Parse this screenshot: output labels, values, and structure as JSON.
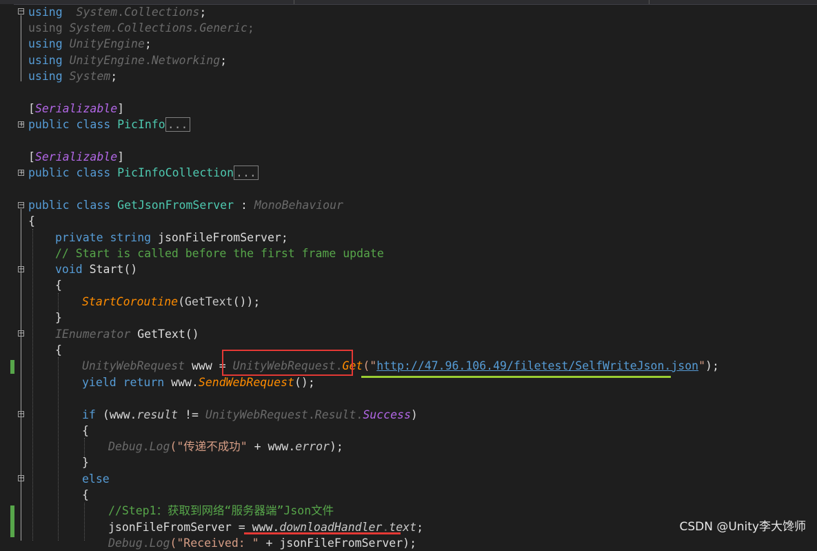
{
  "editor": {
    "lines": [
      {
        "id": "l1",
        "parts": [
          [
            "kw",
            "using"
          ],
          [
            "",
            "  "
          ],
          [
            "tyi",
            "System"
          ],
          [
            "dim",
            "."
          ],
          [
            "tyi",
            "Collections"
          ],
          [
            "",
            "; "
          ]
        ]
      },
      {
        "id": "l2",
        "parts": [
          [
            "dim",
            "using "
          ],
          [
            "dimi",
            "System.Collections.Generic"
          ],
          [
            "dim",
            ";"
          ]
        ]
      },
      {
        "id": "l3",
        "parts": [
          [
            "kw",
            "using "
          ],
          [
            "tyi",
            "UnityEngine"
          ],
          [
            "",
            ";"
          ]
        ]
      },
      {
        "id": "l4",
        "parts": [
          [
            "kw",
            "using "
          ],
          [
            "tyi",
            "UnityEngine"
          ],
          [
            "dim",
            "."
          ],
          [
            "tyi",
            "Networking"
          ],
          [
            "",
            ";"
          ]
        ]
      },
      {
        "id": "l5",
        "parts": [
          [
            "kw",
            "using "
          ],
          [
            "tyi",
            "System"
          ],
          [
            "",
            ";"
          ]
        ]
      },
      {
        "id": "l6",
        "parts": [
          [
            "",
            "["
          ],
          [
            "at",
            "Serializable"
          ],
          [
            "",
            "]"
          ]
        ]
      },
      {
        "id": "l7",
        "parts": [
          [
            "kw",
            "public class "
          ],
          [
            "cl",
            "PicInfo"
          ],
          [
            "collapsed",
            "..."
          ]
        ]
      },
      {
        "id": "l8",
        "parts": [
          [
            "",
            "["
          ],
          [
            "at",
            "Serializable"
          ],
          [
            "",
            "]"
          ]
        ]
      },
      {
        "id": "l9",
        "parts": [
          [
            "kw",
            "public class "
          ],
          [
            "cl",
            "PicInfoCollection"
          ],
          [
            "collapsed",
            "..."
          ]
        ]
      },
      {
        "id": "l10",
        "parts": [
          [
            "kw",
            "public class "
          ],
          [
            "cl",
            "GetJsonFromServer"
          ],
          [
            "",
            " : "
          ],
          [
            "tyi",
            "MonoBehaviour"
          ]
        ]
      },
      {
        "id": "l11",
        "parts": [
          [
            "",
            "{"
          ]
        ]
      },
      {
        "id": "l12",
        "parts": [
          [
            "kw",
            "private string "
          ],
          [
            "",
            "jsonFileFromServer;"
          ]
        ]
      },
      {
        "id": "l13",
        "parts": [
          [
            "cm",
            "// Start is called before the first frame update"
          ]
        ]
      },
      {
        "id": "l14",
        "parts": [
          [
            "kw",
            "void "
          ],
          [
            "",
            "Start()"
          ]
        ]
      },
      {
        "id": "l15",
        "parts": [
          [
            "",
            "{"
          ]
        ]
      },
      {
        "id": "l16",
        "parts": [
          [
            "mi",
            "StartCoroutine"
          ],
          [
            "",
            "("
          ],
          [
            "pr",
            "GetText"
          ],
          [
            "",
            "());"
          ]
        ]
      },
      {
        "id": "l17",
        "parts": [
          [
            "",
            "}"
          ]
        ]
      },
      {
        "id": "l18",
        "parts": [
          [
            "tyi",
            "IEnumerator "
          ],
          [
            "",
            "GetText()"
          ]
        ]
      },
      {
        "id": "l19",
        "parts": [
          [
            "",
            "{"
          ]
        ]
      },
      {
        "id": "l20",
        "parts": [
          [
            "tyi",
            "UnityWebRequest "
          ],
          [
            "",
            "www = "
          ],
          [
            "tyi",
            "UnityWebRequest"
          ],
          [
            "dim",
            "."
          ],
          [
            "mi",
            "Get"
          ],
          [
            "st",
            "(\""
          ],
          [
            "url",
            "http://47.96.106.49/filetest/SelfWriteJson.json"
          ],
          [
            "st",
            "\""
          ],
          [
            "",
            ");"
          ]
        ]
      },
      {
        "id": "l21",
        "parts": [
          [
            "kw",
            "yield return "
          ],
          [
            "",
            "www."
          ],
          [
            "mi",
            "SendWebRequest"
          ],
          [
            "",
            "();"
          ]
        ]
      },
      {
        "id": "l22",
        "parts": [
          [
            "kw",
            "if "
          ],
          [
            "",
            "(www."
          ],
          [
            "pri",
            "result"
          ],
          [
            "",
            " != "
          ],
          [
            "tyi",
            "UnityWebRequest"
          ],
          [
            "dim",
            "."
          ],
          [
            "tyi",
            "Result"
          ],
          [
            "dim",
            "."
          ],
          [
            "at",
            "Success"
          ],
          [
            "",
            ")"
          ]
        ]
      },
      {
        "id": "l23",
        "parts": [
          [
            "",
            "{"
          ]
        ]
      },
      {
        "id": "l24",
        "parts": [
          [
            "tyi",
            "Debug"
          ],
          [
            "dim",
            "."
          ],
          [
            "dimi",
            "Log"
          ],
          [
            "st",
            "(\"传递不成功\""
          ],
          [
            "",
            " + www."
          ],
          [
            "pri",
            "error"
          ],
          [
            "",
            ");"
          ]
        ]
      },
      {
        "id": "l25",
        "parts": [
          [
            "",
            "}"
          ]
        ]
      },
      {
        "id": "l26",
        "parts": [
          [
            "kw",
            "else"
          ]
        ]
      },
      {
        "id": "l27",
        "parts": [
          [
            "",
            "{"
          ]
        ]
      },
      {
        "id": "l28",
        "parts": [
          [
            "cm",
            "//Step1：获取到网络“服务器端”Json文件"
          ]
        ]
      },
      {
        "id": "l29",
        "parts": [
          [
            "",
            "jsonFileFromServer = www."
          ],
          [
            "pri",
            "downloadHandler"
          ],
          [
            "dim",
            "."
          ],
          [
            "pri",
            "text"
          ],
          [
            "",
            ";"
          ]
        ]
      },
      {
        "id": "l30",
        "parts": [
          [
            "tyi",
            "Debug"
          ],
          [
            "dim",
            "."
          ],
          [
            "dimi",
            "Log"
          ],
          [
            "st",
            "(\"Received: \""
          ],
          [
            "",
            " + jsonFileFromServer);"
          ]
        ]
      }
    ]
  },
  "colors": {
    "background": "#1e1e1e",
    "keyword": "#569cd6",
    "comment": "#57a64a",
    "highlight_box": "#e53935",
    "url_underline": "#9acd32"
  },
  "watermark": "CSDN @Unity李大馋师"
}
